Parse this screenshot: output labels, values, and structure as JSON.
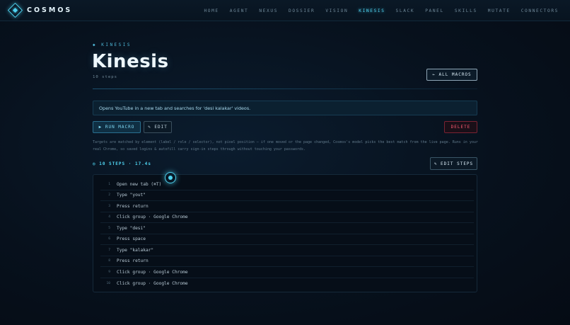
{
  "app": {
    "name": "COSMOS",
    "logo_icon": "diamond-logo-icon",
    "accent": "#4fd3f0"
  },
  "nav": {
    "items": [
      {
        "label": "HOME"
      },
      {
        "label": "AGENT"
      },
      {
        "label": "NEXUS"
      },
      {
        "label": "DOSSIER"
      },
      {
        "label": "VISION"
      },
      {
        "label": "KINESIS",
        "active": true
      },
      {
        "label": "SLACK"
      },
      {
        "label": "PANEL"
      },
      {
        "label": "SKILLS"
      },
      {
        "label": "MUTATE"
      },
      {
        "label": "CONNECTORS"
      }
    ]
  },
  "page": {
    "eyebrow": "◆ KINESIS",
    "title": "Kinesis",
    "subtitle": "10 steps",
    "all_macros_label": "← ALL MACROS",
    "description": "Opens YouTube in a new tab and searches for 'desi kalakar' videos.",
    "run_label": "▶ RUN MACRO",
    "edit_label": "✎ EDIT",
    "delete_label": "DELETE",
    "delete_color": "#ff5a72",
    "note": "Targets are matched by element (label / role / selector), not pixel position — if one moved or the page changed, Cosmos's model picks the best match from the live page. Runs in your real Chrome, so saved logins & autofill carry sign-in steps through without touching your passwords.",
    "steps_heading": "◎ 10 STEPS · 17.4s",
    "edit_steps_label": "✎ EDIT STEPS"
  },
  "steps": [
    {
      "num": "1",
      "text": "Open new tab (⌘T)"
    },
    {
      "num": "2",
      "text": "Type \"yout\""
    },
    {
      "num": "3",
      "text": "Press return"
    },
    {
      "num": "4",
      "text": "Click group · Google Chrome"
    },
    {
      "num": "5",
      "text": "Type \"desi\""
    },
    {
      "num": "6",
      "text": "Press space"
    },
    {
      "num": "7",
      "text": "Type \"kalakar\""
    },
    {
      "num": "8",
      "text": "Press return"
    },
    {
      "num": "9",
      "text": "Click group · Google Chrome"
    },
    {
      "num": "10",
      "text": "Click group · Google Chrome"
    }
  ]
}
